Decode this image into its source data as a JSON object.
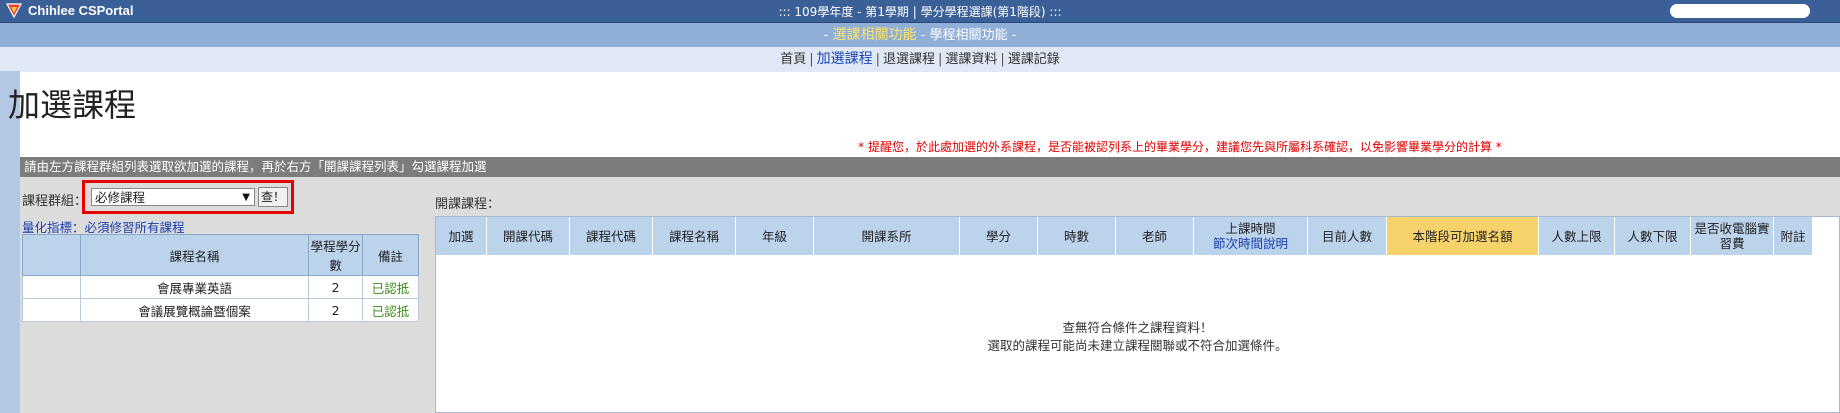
{
  "app": {
    "brand": "Chihlee CSPortal",
    "title": "::: 109學年度 - 第1學期 | 學分學程選課(第1階段) :::"
  },
  "funcbar": {
    "prefix": "- ",
    "active": "選課相關功能",
    "separator": " - ",
    "other": "學程相關功能",
    "suffix": " -"
  },
  "nav": {
    "items": [
      {
        "label": "首頁",
        "active": false
      },
      {
        "label": "加選課程",
        "active": true
      },
      {
        "label": "退選課程",
        "active": false
      },
      {
        "label": "選課資料",
        "active": false
      },
      {
        "label": "選課記錄",
        "active": false
      }
    ],
    "separator": "|"
  },
  "page": {
    "title": "加選課程",
    "notice": "* 提醒您，於此處加選的外系課程，是否能被認列系上的畢業學分，建議您先與所屬科系確認，以免影響畢業學分的計算 *",
    "panel_header": "請由左方課程群組列表選取欲加選的課程，再於右方「開課課程列表」勾選課程加選"
  },
  "left": {
    "group_label": "課程群組：",
    "group_selected": "必修課程",
    "query_button": "查！",
    "quant_link": "量化指標：必須修習所有課程",
    "table_headers": [
      "課程名稱",
      "學程學分數",
      "備註"
    ],
    "rows": [
      {
        "name": "會展專業英語",
        "credits": "2",
        "note": "已認抵"
      },
      {
        "name": "會議展覽概論暨個案",
        "credits": "2",
        "note": "已認抵"
      }
    ]
  },
  "right": {
    "open_label": "開課課程：",
    "headers": [
      {
        "label": "加選"
      },
      {
        "label": "開課代碼"
      },
      {
        "label": "課程代碼"
      },
      {
        "label": "課程名稱"
      },
      {
        "label": "年級"
      },
      {
        "label": "開課系所"
      },
      {
        "label": "學分"
      },
      {
        "label": "時數"
      },
      {
        "label": "老師"
      },
      {
        "label": "上課時間",
        "sub": "節次時間說明"
      },
      {
        "label": "目前人數"
      },
      {
        "label": "本階段可加選名額",
        "highlight": true
      },
      {
        "label": "人數上限"
      },
      {
        "label": "人數下限"
      },
      {
        "label": "是否收電腦實習費"
      },
      {
        "label": "附註"
      }
    ],
    "empty_line1": "查無符合條件之課程資料！",
    "empty_line2": "選取的課程可能尚未建立課程關聯或不符合加選條件。"
  },
  "colors": {
    "topbar": "#3b5f97",
    "funcbar": "#8fafd8",
    "highlight": "#f5d26a",
    "alert": "#e00000"
  }
}
